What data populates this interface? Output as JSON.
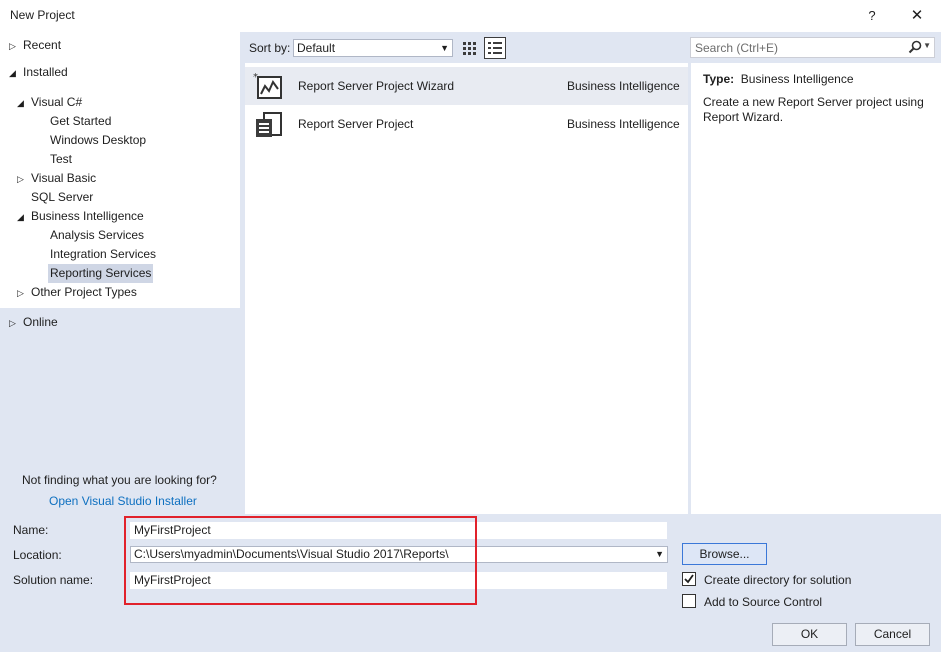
{
  "window": {
    "title": "New Project",
    "help": "?",
    "close": "✕"
  },
  "tree": {
    "recent": "Recent",
    "installed": "Installed",
    "visual_csharp": "Visual C#",
    "get_started": "Get Started",
    "windows_desktop": "Windows Desktop",
    "test": "Test",
    "visual_basic": "Visual Basic",
    "sql_server": "SQL Server",
    "business_intelligence": "Business Intelligence",
    "analysis_services": "Analysis Services",
    "integration_services": "Integration Services",
    "reporting_services": "Reporting Services",
    "other_project_types": "Other Project Types",
    "online": "Online"
  },
  "sort": {
    "label": "Sort by:",
    "value": "Default"
  },
  "search": {
    "placeholder": "Search (Ctrl+E)"
  },
  "templates": [
    {
      "name": "Report Server Project Wizard",
      "category": "Business Intelligence",
      "icon": "report-wizard-icon"
    },
    {
      "name": "Report Server Project",
      "category": "Business Intelligence",
      "icon": "report-project-icon"
    }
  ],
  "description": {
    "type_label": "Type:",
    "type_value": "Business Intelligence",
    "text": "Create a new Report Server project using Report Wizard."
  },
  "help": {
    "not_finding": "Not finding what you are looking for?",
    "installer_link": "Open Visual Studio Installer"
  },
  "form": {
    "name_label": "Name:",
    "name_value": "MyFirstProject",
    "location_label": "Location:",
    "location_value": "C:\\Users\\myadmin\\Documents\\Visual Studio 2017\\Reports\\",
    "solution_label": "Solution name:",
    "solution_value": "MyFirstProject",
    "browse": "Browse...",
    "create_dir_label": "Create directory for solution",
    "create_dir_checked": true,
    "source_control_label": "Add to Source Control",
    "source_control_checked": false,
    "ok": "OK",
    "cancel": "Cancel"
  },
  "colors": {
    "accent": "#0e70c0",
    "highlight_box": "#e1222b",
    "panel_bg": "#e0e6f2"
  }
}
